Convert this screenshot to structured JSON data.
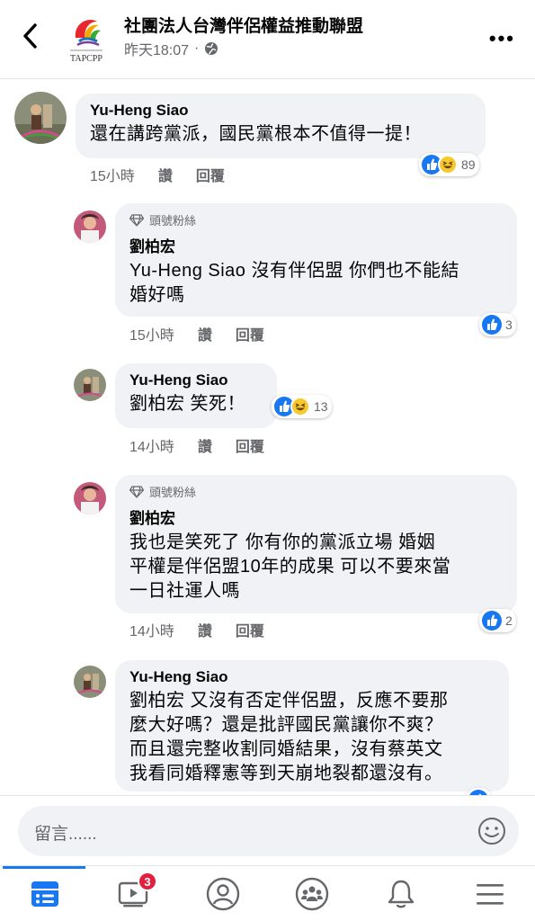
{
  "header": {
    "page_name": "社團法人台灣伴侶權益推動聯盟",
    "post_time": "昨天18:07",
    "dot": "·",
    "more": "•••",
    "logo_text": "TAPCPP"
  },
  "comments": [
    {
      "author": "Yu-Heng Siao",
      "text": "還在講跨黨派，國民黨根本不值得一提！",
      "time": "15小時",
      "like_label": "讚",
      "reply_label": "回覆",
      "reaction_count": "89",
      "reactions": [
        "like-icon",
        "haha-icon"
      ]
    },
    {
      "badge": "頭號粉絲",
      "author": "劉柏宏",
      "text_lines": [
        "Yu-Heng Siao 沒有伴侶盟 你們也不能結",
        "婚好嗎"
      ],
      "time": "15小時",
      "like_label": "讚",
      "reply_label": "回覆",
      "reaction_count": "3",
      "reactions": [
        "like-icon"
      ]
    },
    {
      "author": "Yu-Heng Siao",
      "text": "劉柏宏 笑死！",
      "time": "14小時",
      "like_label": "讚",
      "reply_label": "回覆",
      "reaction_count": "13",
      "reactions": [
        "like-icon",
        "haha-icon"
      ]
    },
    {
      "badge": "頭號粉絲",
      "author": "劉柏宏",
      "text_lines": [
        "我也是笑死了 你有你的黨派立場  婚姻",
        "平權是伴侶盟10年的成果  可以不要來當",
        "一日社運人嗎"
      ],
      "time": "14小時",
      "like_label": "讚",
      "reply_label": "回覆",
      "reaction_count": "2",
      "reactions": [
        "like-icon"
      ]
    },
    {
      "author": "Yu-Heng Siao",
      "text_lines": [
        "劉柏宏 又沒有否定伴侶盟，反應不要那",
        "麼大好嗎？還是批評國民黨讓你不爽？",
        "而且還完整收割同婚結果，沒有蔡英文",
        "我看同婚釋憲等到天崩地裂都還沒有。"
      ],
      "reactions": [
        "like-icon"
      ]
    }
  ],
  "composer": {
    "placeholder": "留言......"
  },
  "tabbar": {
    "tabs": [
      {
        "name": "news-feed-icon",
        "active": true
      },
      {
        "name": "watch-icon",
        "badge": "3"
      },
      {
        "name": "profile-icon"
      },
      {
        "name": "groups-icon"
      },
      {
        "name": "notifications-icon"
      },
      {
        "name": "menu-icon"
      }
    ]
  },
  "colors": {
    "accent": "#1877f2",
    "bubble": "#f0f2f5",
    "badge": "#e41e3f",
    "secondary_text": "#65676b"
  }
}
